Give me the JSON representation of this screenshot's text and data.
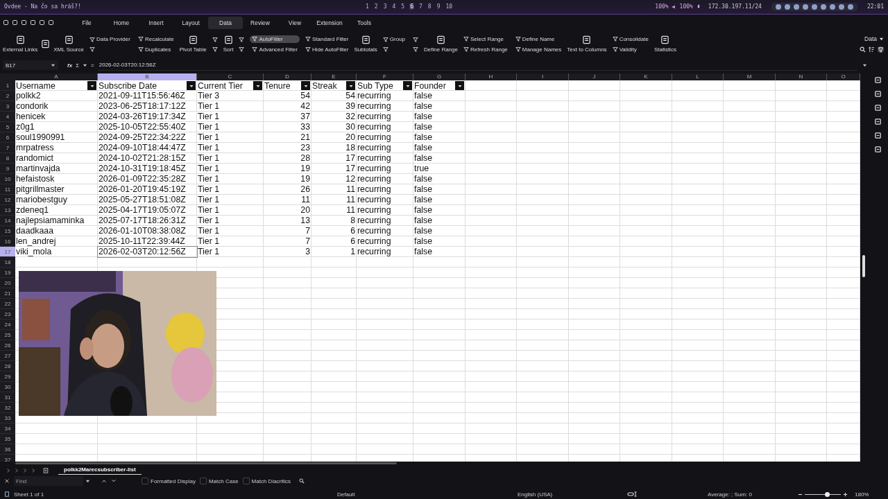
{
  "system_bar": {
    "window_title": "Ovdee - Na čo sa hráš?!",
    "workspaces": [
      {
        "label": "1",
        "selected": false
      },
      {
        "label": "2",
        "selected": false
      },
      {
        "label": "3",
        "selected": false
      },
      {
        "label": "4",
        "selected": false
      },
      {
        "label": "5",
        "selected": false
      },
      {
        "label": "6",
        "selected": true
      },
      {
        "label": "7",
        "selected": false
      },
      {
        "label": "8",
        "selected": false
      },
      {
        "label": "9",
        "selected": false
      },
      {
        "label": "10",
        "selected": false
      }
    ],
    "volume": "100%",
    "mic": "100%",
    "network": "172.30.197.11/24",
    "time": "22:01"
  },
  "menu_tabs": [
    {
      "label": "File",
      "selected": false
    },
    {
      "label": "Home",
      "selected": false
    },
    {
      "label": "Insert",
      "selected": false
    },
    {
      "label": "Layout",
      "selected": false
    },
    {
      "label": "Data",
      "selected": true
    },
    {
      "label": "Review",
      "selected": false
    },
    {
      "label": "View",
      "selected": false
    },
    {
      "label": "Extension",
      "selected": false
    },
    {
      "label": "Tools",
      "selected": false
    }
  ],
  "ribbon": [
    {
      "kind": "large",
      "label": "External Links"
    },
    {
      "kind": "large"
    },
    {
      "kind": "large",
      "label": "XML Source"
    },
    {
      "kind": "stack",
      "items": [
        {
          "label": "Data Provider",
          "on": false
        },
        {
          "on": false
        }
      ]
    },
    {
      "kind": "stack",
      "items": [
        {
          "label": "Recalculate",
          "on": false
        },
        {
          "label": "Duplicates",
          "on": false
        }
      ]
    },
    {
      "kind": "large",
      "label": "Pivot Table"
    },
    {
      "kind": "stack",
      "items": [
        {
          "on": false
        },
        {
          "on": false
        }
      ]
    },
    {
      "kind": "large",
      "label": "Sort"
    },
    {
      "kind": "stack",
      "items": [
        {
          "on": false
        },
        {
          "on": false
        }
      ]
    },
    {
      "kind": "stack",
      "items": [
        {
          "label": "AutoFilter",
          "on": true
        },
        {
          "label": "Advanced Filter",
          "on": false
        }
      ]
    },
    {
      "kind": "stack",
      "items": [
        {
          "label": "Standard Filter",
          "on": false
        },
        {
          "label": "Hide AutoFilter",
          "on": false
        }
      ]
    },
    {
      "kind": "large",
      "label": "Subtotals"
    },
    {
      "kind": "stack",
      "items": [
        {
          "label": "Group",
          "on": false
        },
        {
          "on": false
        }
      ]
    },
    {
      "kind": "stack",
      "items": [
        {
          "on": false
        },
        {
          "on": false
        }
      ]
    },
    {
      "kind": "large",
      "label": "Define Range"
    },
    {
      "kind": "stack",
      "items": [
        {
          "label": "Select Range",
          "on": false
        },
        {
          "label": "Refresh Range",
          "on": false
        }
      ]
    },
    {
      "kind": "stack",
      "items": [
        {
          "label": "Define Name",
          "on": false
        },
        {
          "label": "Manage Names",
          "on": false
        }
      ]
    },
    {
      "kind": "large",
      "label": "Text to Columns"
    },
    {
      "kind": "stack",
      "items": [
        {
          "label": "Consolidate",
          "on": false
        },
        {
          "label": "Validity",
          "on": false
        }
      ]
    },
    {
      "kind": "large",
      "label": "Statistics"
    }
  ],
  "ribbon_switcher": {
    "label": "Data"
  },
  "formula_bar": {
    "name_box": "B17",
    "fx": "fx",
    "sum": "Σ",
    "equals": "=",
    "content": "2026-02-03T20:12:56Z"
  },
  "sheet": {
    "columns": [
      {
        "letter": "A",
        "selected": false,
        "kind": "text"
      },
      {
        "letter": "B",
        "selected": true,
        "kind": "text"
      },
      {
        "letter": "C",
        "selected": false,
        "kind": "text"
      },
      {
        "letter": "D",
        "selected": false,
        "kind": "number"
      },
      {
        "letter": "E",
        "selected": false,
        "kind": "number"
      },
      {
        "letter": "F",
        "selected": false,
        "kind": "text"
      },
      {
        "letter": "G",
        "selected": false,
        "kind": "text"
      },
      {
        "letter": "H",
        "selected": false
      },
      {
        "letter": "I",
        "selected": false
      },
      {
        "letter": "J",
        "selected": false
      },
      {
        "letter": "K",
        "selected": false
      },
      {
        "letter": "L",
        "selected": false
      },
      {
        "letter": "M",
        "selected": false
      },
      {
        "letter": "N",
        "selected": false
      },
      {
        "letter": "O",
        "selected": false
      }
    ],
    "row_numbers": [
      {
        "label": "1",
        "selected": false
      },
      {
        "label": "2",
        "selected": false
      },
      {
        "label": "3",
        "selected": false
      },
      {
        "label": "4",
        "selected": false
      },
      {
        "label": "5",
        "selected": false
      },
      {
        "label": "6",
        "selected": false
      },
      {
        "label": "7",
        "selected": false
      },
      {
        "label": "8",
        "selected": false
      },
      {
        "label": "9",
        "selected": false
      },
      {
        "label": "10",
        "selected": false
      },
      {
        "label": "11",
        "selected": false
      },
      {
        "label": "12",
        "selected": false
      },
      {
        "label": "13",
        "selected": false
      },
      {
        "label": "14",
        "selected": false
      },
      {
        "label": "15",
        "selected": false
      },
      {
        "label": "16",
        "selected": false
      },
      {
        "label": "17",
        "selected": true
      },
      {
        "label": "18",
        "selected": false
      },
      {
        "label": "19",
        "selected": false
      },
      {
        "label": "20",
        "selected": false
      },
      {
        "label": "21",
        "selected": false
      },
      {
        "label": "22",
        "selected": false
      },
      {
        "label": "23",
        "selected": false
      },
      {
        "label": "24",
        "selected": false
      },
      {
        "label": "25",
        "selected": false
      },
      {
        "label": "26",
        "selected": false
      },
      {
        "label": "27",
        "selected": false
      },
      {
        "label": "28",
        "selected": false
      },
      {
        "label": "29",
        "selected": false
      },
      {
        "label": "30",
        "selected": false
      },
      {
        "label": "31",
        "selected": false
      },
      {
        "label": "32",
        "selected": false
      },
      {
        "label": "33",
        "selected": false
      },
      {
        "label": "34",
        "selected": false
      },
      {
        "label": "35",
        "selected": false
      },
      {
        "label": "36",
        "selected": false
      },
      {
        "label": "37",
        "selected": false
      }
    ],
    "headers": [
      "Username",
      "Subscribe Date",
      "Current Tier",
      "Tenure",
      "Streak",
      "Sub Type",
      "Founder"
    ],
    "rows": [
      {
        "cells": [
          "polkk2",
          "2021-09-11T15:56:46Z",
          "Tier 3",
          "54",
          "54",
          "recurring",
          "false"
        ]
      },
      {
        "cells": [
          "condorik",
          "2023-06-25T18:17:12Z",
          "Tier 1",
          "42",
          "39",
          "recurring",
          "false"
        ]
      },
      {
        "cells": [
          "henicek",
          "2024-03-26T19:17:34Z",
          "Tier 1",
          "37",
          "32",
          "recurring",
          "false"
        ]
      },
      {
        "cells": [
          "z0g1",
          "2025-10-05T22:55:40Z",
          "Tier 1",
          "33",
          "30",
          "recurring",
          "false"
        ]
      },
      {
        "cells": [
          "soul1990991",
          "2024-09-25T22:34:22Z",
          "Tier 1",
          "21",
          "20",
          "recurring",
          "false"
        ]
      },
      {
        "cells": [
          "mrpatress",
          "2024-09-10T18:44:47Z",
          "Tier 1",
          "23",
          "18",
          "recurring",
          "false"
        ]
      },
      {
        "cells": [
          "randomict",
          "2024-10-02T21:28:15Z",
          "Tier 1",
          "28",
          "17",
          "recurring",
          "false"
        ]
      },
      {
        "cells": [
          "martinvajda",
          "2024-10-31T19:18:45Z",
          "Tier 1",
          "19",
          "17",
          "recurring",
          "true"
        ]
      },
      {
        "cells": [
          "hefaistosk",
          "2026-01-09T22:35:28Z",
          "Tier 1",
          "19",
          "12",
          "recurring",
          "false"
        ]
      },
      {
        "cells": [
          "pitgrillmaster",
          "2026-01-20T19:45:19Z",
          "Tier 1",
          "26",
          "11",
          "recurring",
          "false"
        ]
      },
      {
        "cells": [
          "mariobestguy",
          "2025-05-27T18:51:08Z",
          "Tier 1",
          "11",
          "11",
          "recurring",
          "false"
        ]
      },
      {
        "cells": [
          "zdeneq1",
          "2025-04-17T19:05:07Z",
          "Tier 1",
          "20",
          "11",
          "recurring",
          "false"
        ]
      },
      {
        "cells": [
          "najlepsiamaminka",
          "2025-07-17T18:26:31Z",
          "Tier 1",
          "13",
          "8",
          "recurring",
          "false"
        ]
      },
      {
        "cells": [
          "daadkaaa",
          "2026-01-10T08:38:08Z",
          "Tier 1",
          "7",
          "6",
          "recurring",
          "false"
        ]
      },
      {
        "cells": [
          "len_andrej",
          "2025-10-11T22:39:44Z",
          "Tier 1",
          "7",
          "6",
          "recurring",
          "false"
        ]
      },
      {
        "cells": [
          "viki_mola",
          "2026-02-03T20:12:56Z",
          "Tier 1",
          "3",
          "1",
          "recurring",
          "false"
        ]
      }
    ]
  },
  "sheet_tabs": [
    {
      "label": "polkk2Marecsubscriber-list",
      "selected": true
    }
  ],
  "find_bar": {
    "placeholder": "Find",
    "options": [
      {
        "label": "Formatted Display",
        "checked": false
      },
      {
        "label": "Match Case",
        "checked": false
      },
      {
        "label": "Match Diacritics",
        "checked": false
      }
    ]
  },
  "status_bar": {
    "sheet": "Sheet 1 of 1",
    "page_style": "Default",
    "language": "English (USA)",
    "summary": "Average: ; Sum: 0",
    "zoom": {
      "level": 0.62
    },
    "zoom_label": "180%"
  }
}
